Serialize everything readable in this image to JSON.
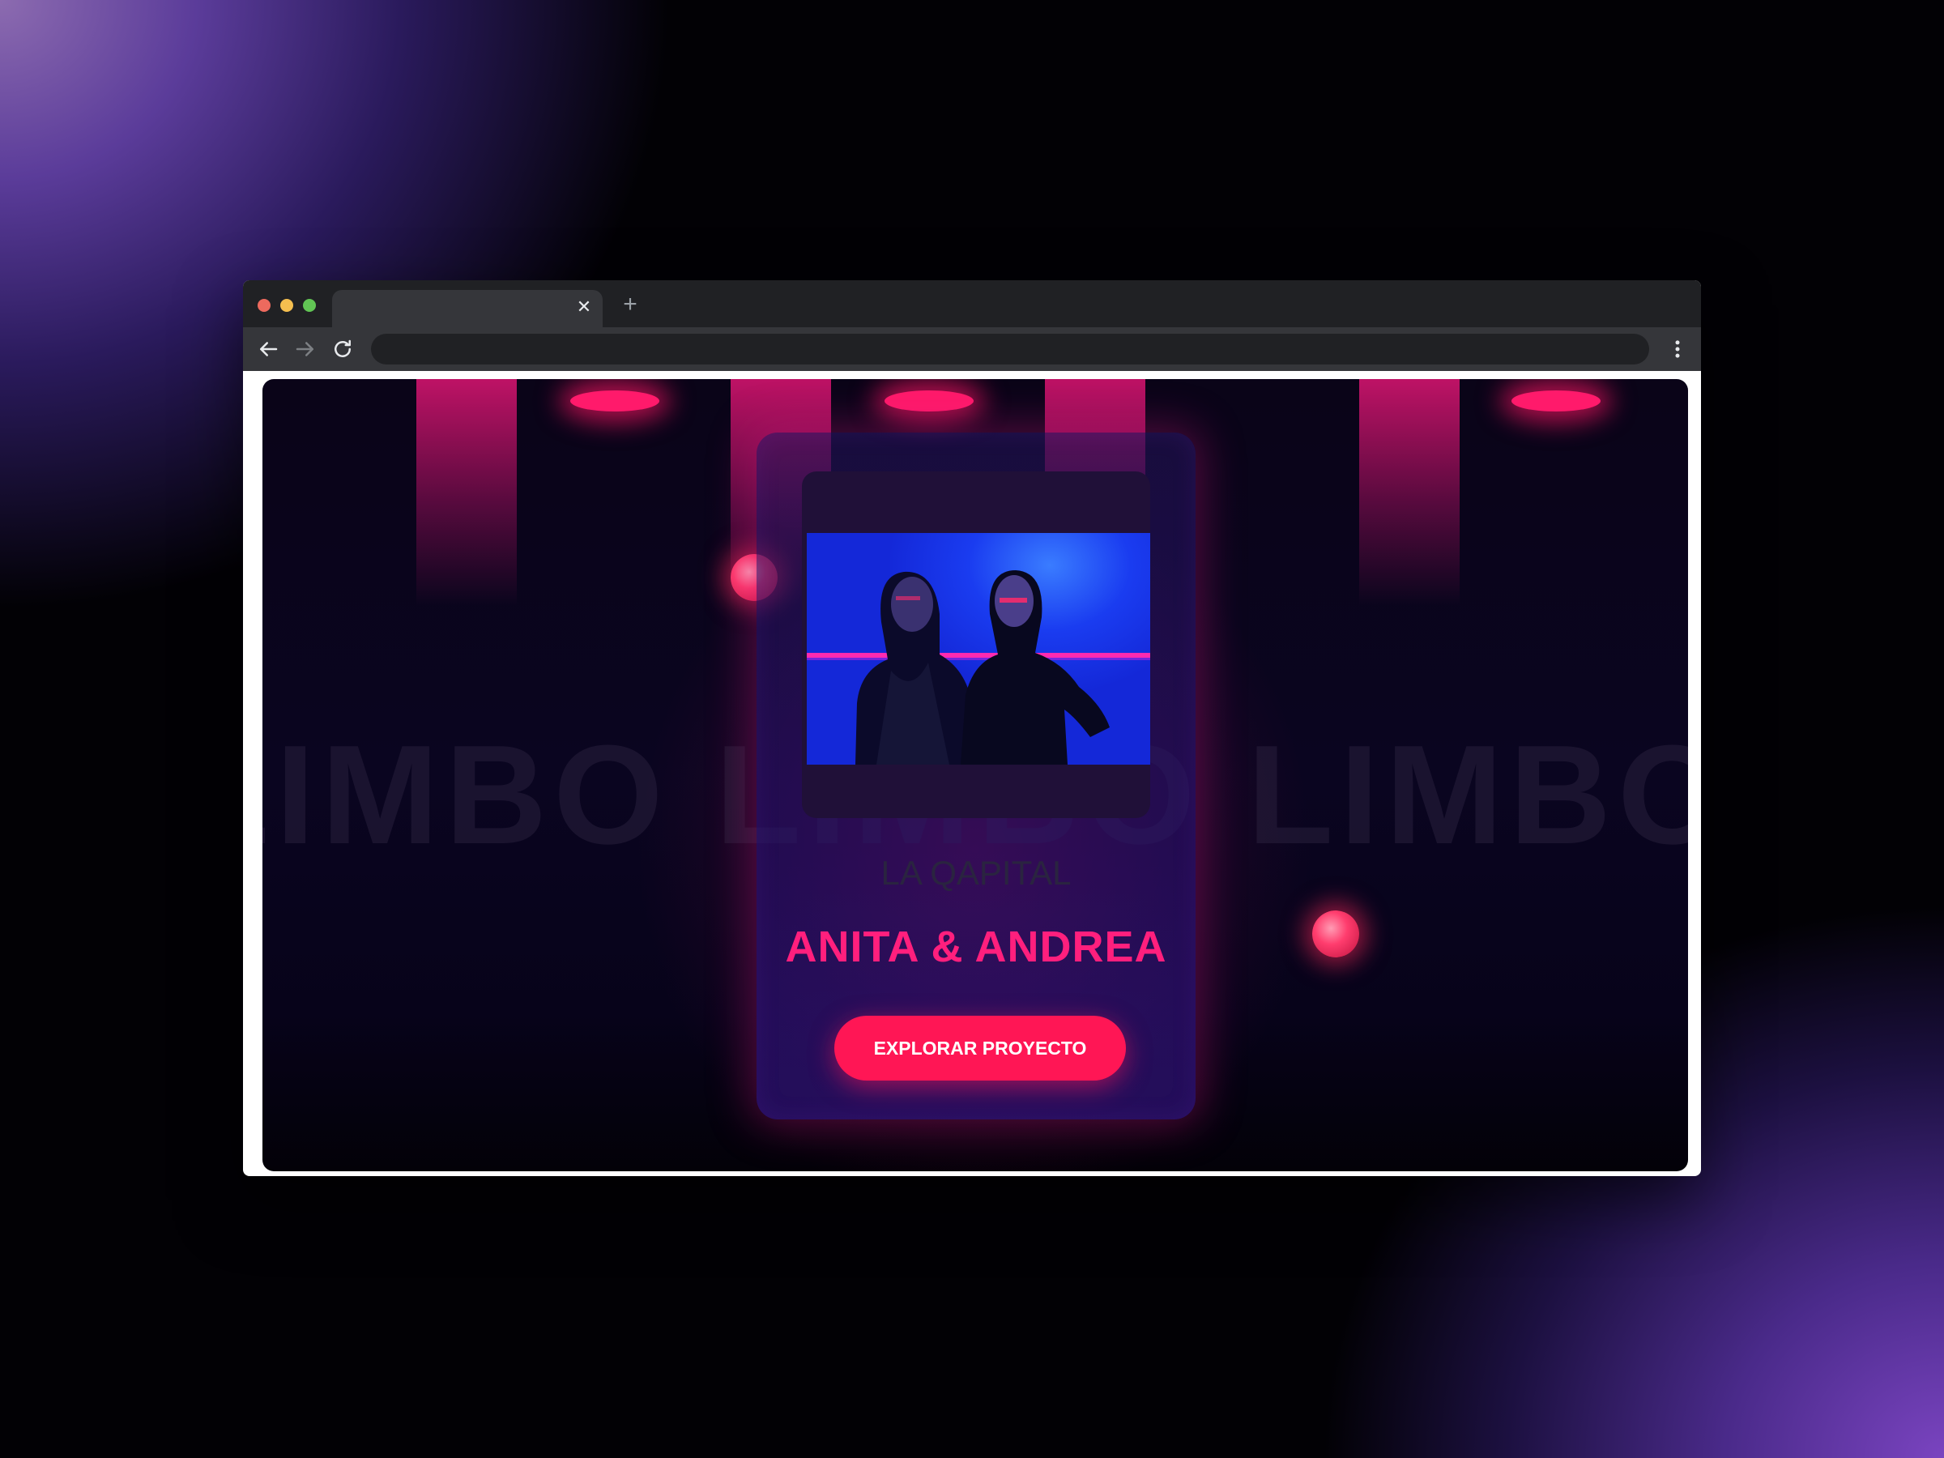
{
  "browser": {
    "tab_title": "",
    "tab_close": "✕",
    "new_tab": "+",
    "address": ""
  },
  "hero": {
    "background_word": "LIMBO",
    "background_text": "LIMBO LIMBO LIMBO LIMBO",
    "kicker": "LA QAPITAL",
    "title": "ANITA & ANDREA",
    "cta_label": "EXPLORAR PROYECTO"
  },
  "colors": {
    "accent": "#ff1f7d",
    "button": "#ff1655",
    "photo_blue": "#1a3cf0"
  },
  "icons": [
    "back-arrow-icon",
    "forward-arrow-icon",
    "reload-icon",
    "more-menu-icon",
    "close-icon",
    "plus-icon"
  ]
}
